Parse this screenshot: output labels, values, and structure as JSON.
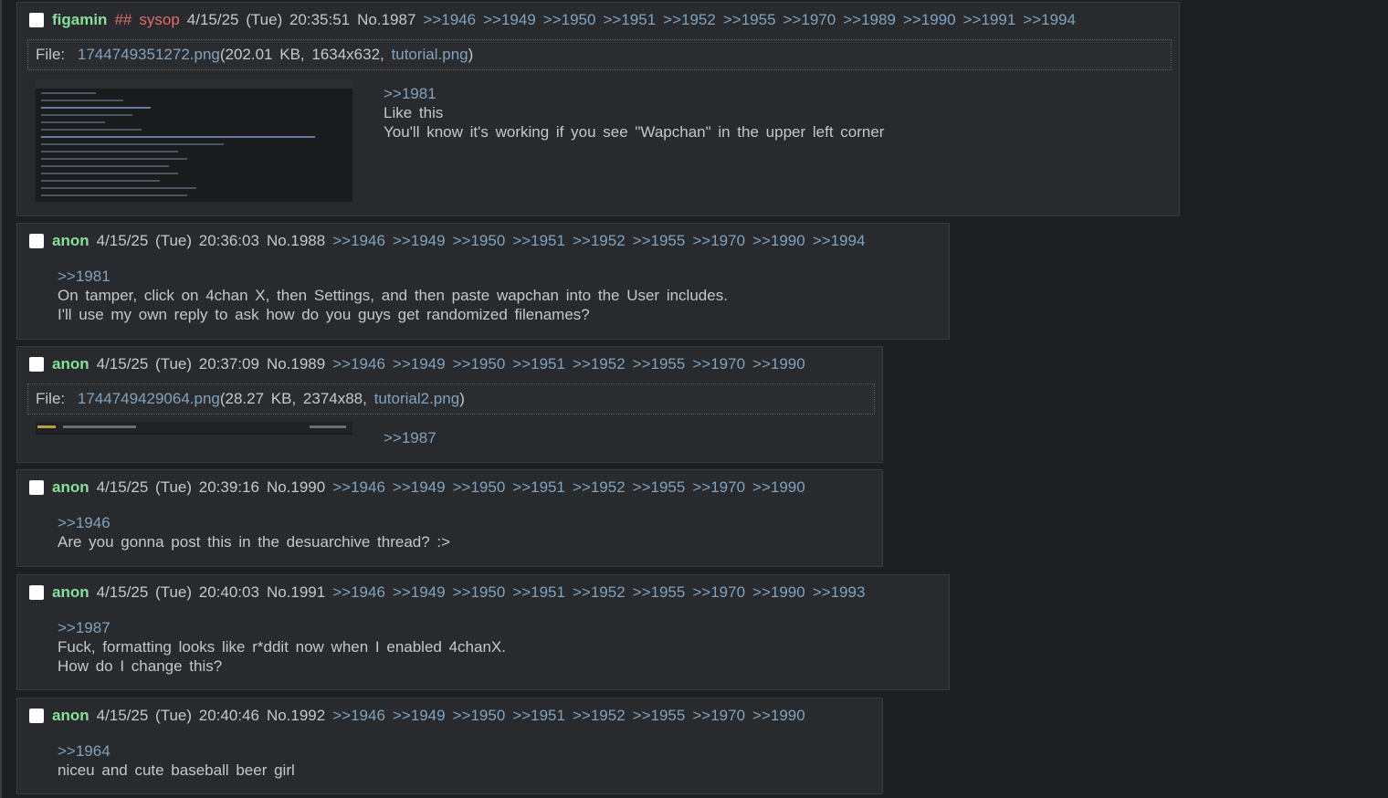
{
  "posts": [
    {
      "name": "figamin",
      "tripcode": "##",
      "capcode": "sysop",
      "datetime": "4/15/25 (Tue) 20:35:51",
      "number": "No.1987",
      "replies": [
        ">>1946",
        ">>1949",
        ">>1950",
        ">>1951",
        ">>1952",
        ">>1955",
        ">>1970",
        ">>1989",
        ">>1990",
        ">>1991",
        ">>1994"
      ],
      "file": {
        "label": "File:",
        "filename": "1744749351272.png",
        "info": "(202.01 KB, 1634x632,",
        "original_name": "tutorial.png",
        "close": ")"
      },
      "quote": ">>1981",
      "lines": [
        "Like this",
        "You'll know it's working if you see \"Wapchan\" in the upper left corner"
      ]
    },
    {
      "name": "anon",
      "datetime": "4/15/25 (Tue) 20:36:03",
      "number": "No.1988",
      "replies": [
        ">>1946",
        ">>1949",
        ">>1950",
        ">>1951",
        ">>1952",
        ">>1955",
        ">>1970",
        ">>1990",
        ">>1994"
      ],
      "quote": ">>1981",
      "lines": [
        "On tamper, click on 4chan X, then Settings, and then paste wapchan into the User includes.",
        "I'll use my own reply to ask how do you guys get randomized filenames?"
      ]
    },
    {
      "name": "anon",
      "datetime": "4/15/25 (Tue) 20:37:09",
      "number": "No.1989",
      "replies": [
        ">>1946",
        ">>1949",
        ">>1950",
        ">>1951",
        ">>1952",
        ">>1955",
        ">>1970",
        ">>1990"
      ],
      "file": {
        "label": "File:",
        "filename": "1744749429064.png",
        "info": "(28.27 KB, 2374x88,",
        "original_name": "tutorial2.png",
        "close": ")"
      },
      "quote": ">>1987",
      "lines": []
    },
    {
      "name": "anon",
      "datetime": "4/15/25 (Tue) 20:39:16",
      "number": "No.1990",
      "replies": [
        ">>1946",
        ">>1949",
        ">>1950",
        ">>1951",
        ">>1952",
        ">>1955",
        ">>1970",
        ">>1990"
      ],
      "quote": ">>1946",
      "lines": [
        "Are you gonna post this in the desuarchive thread? :>"
      ]
    },
    {
      "name": "anon",
      "datetime": "4/15/25 (Tue) 20:40:03",
      "number": "No.1991",
      "replies": [
        ">>1946",
        ">>1949",
        ">>1950",
        ">>1951",
        ">>1952",
        ">>1955",
        ">>1970",
        ">>1990",
        ">>1993"
      ],
      "quote": ">>1987",
      "lines": [
        "Fuck, formatting looks like r*ddit now when I enabled 4chanX.",
        "How do I change this?"
      ]
    },
    {
      "name": "anon",
      "datetime": "4/15/25 (Tue) 20:40:46",
      "number": "No.1992",
      "replies": [
        ">>1946",
        ">>1949",
        ">>1950",
        ">>1951",
        ">>1952",
        ">>1955",
        ">>1970",
        ">>1990"
      ],
      "quote": ">>1964",
      "lines": [
        "niceu and cute baseball beer girl"
      ]
    }
  ],
  "colors": {
    "background": "#1d1f21",
    "post_background": "#282a2e",
    "name": "#85e09c",
    "capcode": "#e06c6c",
    "link": "#81a2be",
    "text": "#c5c8c6"
  }
}
